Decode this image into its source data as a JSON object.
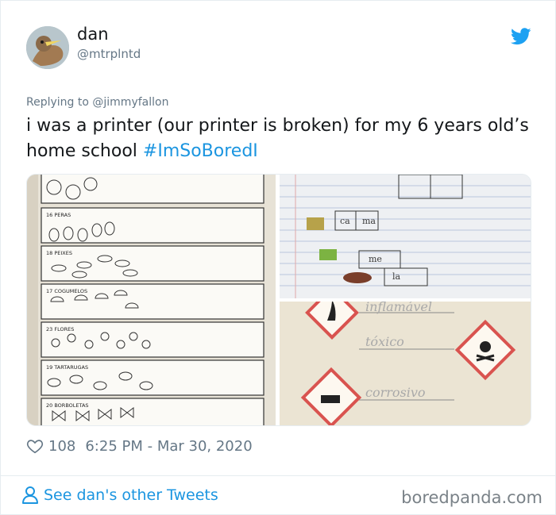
{
  "tweet": {
    "display_name": "dan",
    "handle": "@mtrplntd",
    "replying_prefix": "Replying to",
    "replying_to": "@jimmyfallon",
    "text_main": "i was a printer (our printer is broken) for my 6 years old’s home school ",
    "hashtag": "#ImSoBoredI",
    "likes": "108",
    "timestamp": "6:25 PM - Mar 30, 2020"
  },
  "worksheet_labels": [
    "16 PERAS",
    "18 PEIXES",
    "17 COGUMELOS",
    "23 FLORES",
    "19 TARTARUGAS",
    "20 BORBOLETAS"
  ],
  "syllable_cells": [
    "ca",
    "ma",
    "me",
    "la"
  ],
  "hazard_words": [
    "inflamável",
    "tóxico",
    "corrosivo"
  ],
  "footer": {
    "see_more": "See dan's other Tweets",
    "watermark": "boredpanda.com"
  },
  "icons": {
    "brand": "twitter-bird-icon",
    "like": "heart-icon",
    "profile": "person-icon"
  },
  "colors": {
    "accent": "#1b95e0",
    "secondary_text": "#657786",
    "twitter_blue": "#1da1f2"
  }
}
